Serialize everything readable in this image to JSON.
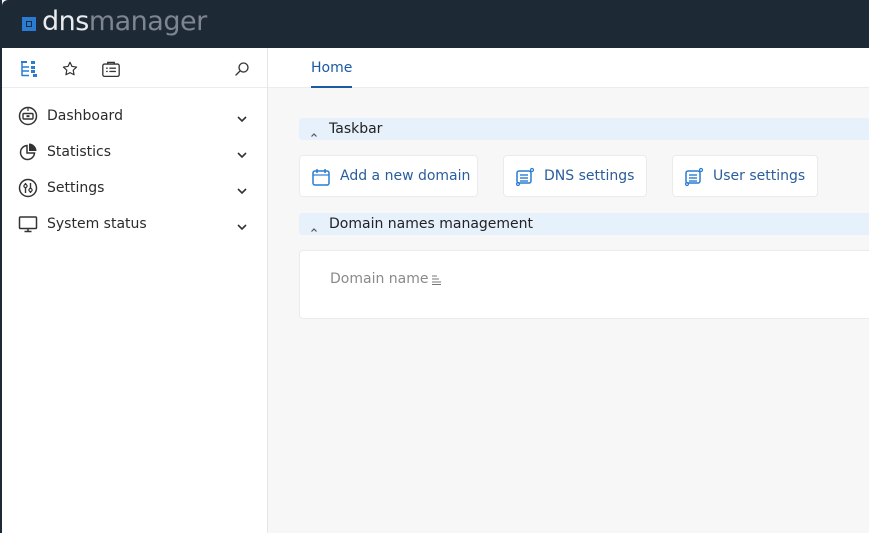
{
  "app": {
    "logo_part1": "dns",
    "logo_part2": "manager",
    "brand_color": "#2a7cd3",
    "header_bg": "#1e2936"
  },
  "sidebar": {
    "toolbar_icons": [
      "tree-icon",
      "star-icon",
      "briefcase-icon",
      "search-icon"
    ],
    "items": [
      {
        "label": "Dashboard",
        "icon": "dashboard-icon"
      },
      {
        "label": "Statistics",
        "icon": "pie-chart-icon"
      },
      {
        "label": "Settings",
        "icon": "sliders-icon"
      },
      {
        "label": "System status",
        "icon": "monitor-icon"
      }
    ]
  },
  "tabs": [
    {
      "label": "Home",
      "active": true
    }
  ],
  "main": {
    "taskbar": {
      "title": "Taskbar",
      "buttons": [
        {
          "label": "Add a new domain",
          "icon": "calendar-add-icon"
        },
        {
          "label": "DNS settings",
          "icon": "server-settings-icon"
        },
        {
          "label": "User settings",
          "icon": "server-settings-icon"
        }
      ]
    },
    "domains": {
      "title": "Domain names management",
      "columns": [
        {
          "label": "Domain name",
          "sortable": true
        }
      ],
      "rows": []
    }
  }
}
